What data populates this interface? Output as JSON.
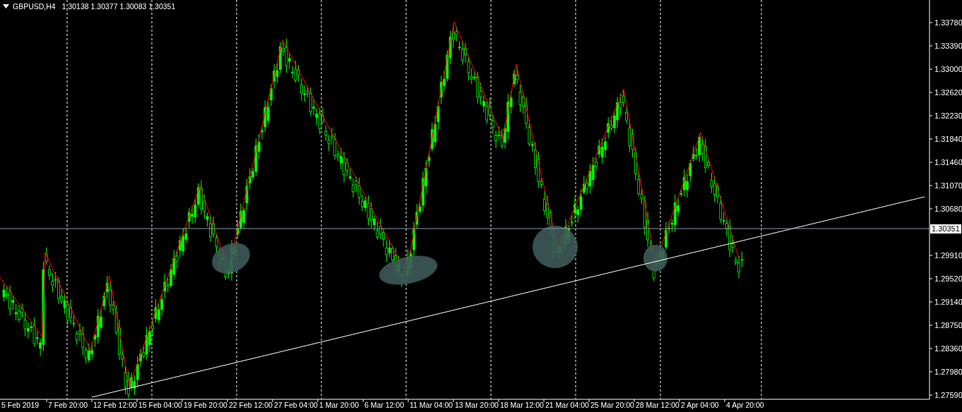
{
  "header": {
    "symbol": "GBPUSD,H4",
    "quotes": [
      "1.30138",
      "1.30377",
      "1.30083",
      "1.30351"
    ]
  },
  "price_axis_upper": [
    "1.33780",
    "1.33390",
    "1.33000",
    "1.32620",
    "1.32230",
    "1.31840",
    "1.31460",
    "1.31070",
    "1.30680"
  ],
  "price_axis_lower": [
    "1.29910",
    "1.29520",
    "1.29140",
    "1.28750",
    "1.28360",
    "1.27980",
    "1.27590"
  ],
  "current_price": "1.30351",
  "time_axis": [
    "5 Feb 2019",
    "7 Feb 20:00",
    "12 Feb 12:00",
    "15 Feb 04:00",
    "19 Feb 20:00",
    "22 Feb 12:00",
    "27 Feb 04:00",
    "1 Mar 20:00",
    "6 Mar 12:00",
    "11 Mar 04:00",
    "13 Mar 20:00",
    "18 Mar 12:00",
    "21 Mar 04:00",
    "25 Mar 20:00",
    "28 Mar 12:00",
    "2 Apr 04:00",
    "4 Apr 20:00"
  ]
}
